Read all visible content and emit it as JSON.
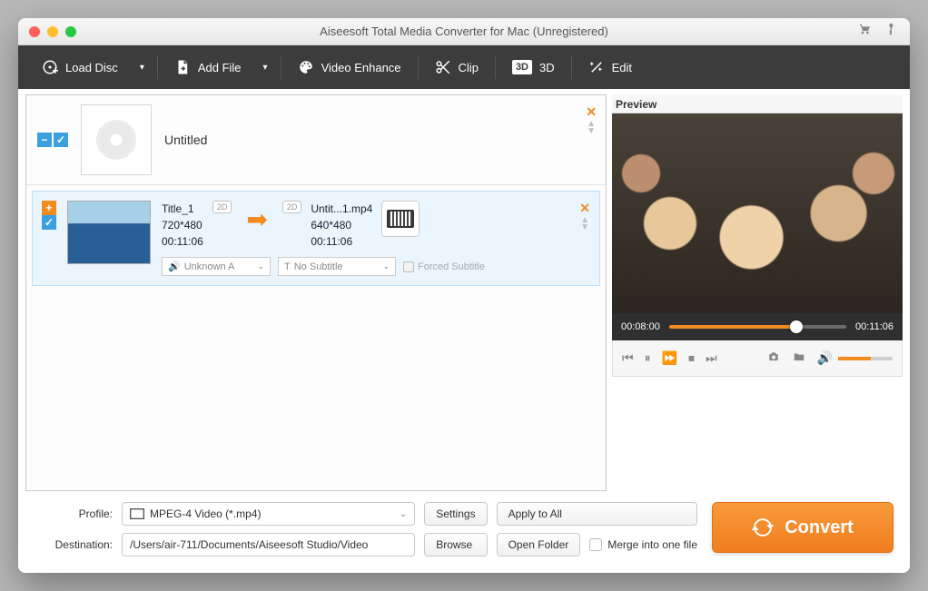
{
  "window": {
    "title": "Aiseesoft Total Media Converter for Mac (Unregistered)"
  },
  "toolbar": {
    "load_disc": "Load Disc",
    "add_file": "Add File",
    "video_enhance": "Video Enhance",
    "clip": "Clip",
    "three_d": "3D",
    "edit": "Edit"
  },
  "group": {
    "title": "Untitled"
  },
  "item": {
    "src": {
      "title": "Title_1",
      "resolution": "720*480",
      "duration": "00:11:06",
      "badge": "2D"
    },
    "dst": {
      "title": "Untit...1.mp4",
      "resolution": "640*480",
      "duration": "00:11:06",
      "badge": "2D"
    },
    "audio_select": "Unknown A",
    "subtitle_select": "No Subtitle",
    "forced_subtitle": "Forced Subtitle"
  },
  "preview": {
    "label": "Preview",
    "current_time": "00:08:00",
    "total_time": "00:11:06"
  },
  "bottom": {
    "profile_label": "Profile:",
    "profile_value": "MPEG-4 Video (*.mp4)",
    "settings": "Settings",
    "apply_all": "Apply to All",
    "destination_label": "Destination:",
    "destination_value": "/Users/air-711/Documents/Aiseesoft Studio/Video",
    "browse": "Browse",
    "open_folder": "Open Folder",
    "merge": "Merge into one file",
    "convert": "Convert"
  },
  "icons": {
    "speaker": "🔈",
    "text": "T",
    "audio_prefix": "🔊"
  }
}
